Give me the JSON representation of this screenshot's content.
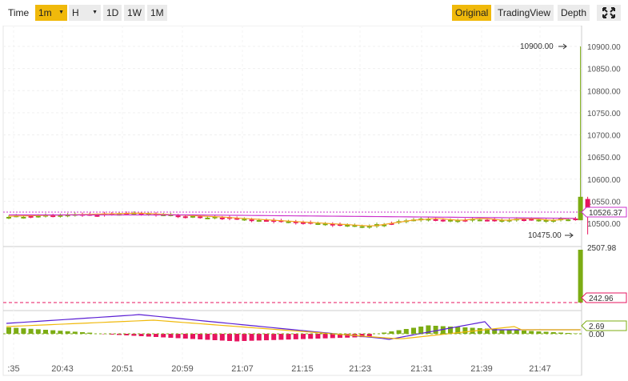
{
  "toolbar": {
    "time_label": "Time",
    "interval_1m": "1m",
    "interval_h": "H",
    "interval_1d": "1D",
    "interval_1w": "1W",
    "interval_1M": "1M",
    "view_original": "Original",
    "view_tradingview": "TradingView",
    "view_depth": "Depth",
    "expand_icon": "expand-icon"
  },
  "colors": {
    "up": "#7cac13",
    "down": "#e7145f",
    "ma7": "#f5a623",
    "ma25": "#cc33cc",
    "dif": "#5b1fd4",
    "dea": "#f0b90b",
    "accent": "#f0b90b"
  },
  "price_axis": {
    "labels": [
      "10900.00",
      "10850.00",
      "10800.00",
      "10750.00",
      "10700.00",
      "10650.00",
      "10600.00",
      "10550.00",
      "10500.00"
    ],
    "current_label": "10526.37",
    "high_marker": "10900.00",
    "low_marker": "10475.00"
  },
  "volume_axis": {
    "max_label": "2507.98",
    "current_label": "242.96"
  },
  "macd_axis": {
    "current_label": "2.69",
    "zero_label": "0.00"
  },
  "time_axis": {
    "labels": [
      ":35",
      "20:43",
      "20:51",
      "20:59",
      "21:07",
      "21:15",
      "21:23",
      "21:31",
      "21:39",
      "21:47"
    ]
  },
  "chart_data": {
    "type": "candlestick",
    "price_range": [
      10475,
      10900
    ],
    "current_price": 10526.37,
    "high": 10900.0,
    "low": 10475.0,
    "volume_max": 2507.98,
    "volume_current": 242.96,
    "macd_current": 2.69,
    "x_labels": [
      ":35",
      "20:43",
      "20:51",
      "20:59",
      "21:07",
      "21:15",
      "21:23",
      "21:31",
      "21:39",
      "21:47"
    ]
  }
}
